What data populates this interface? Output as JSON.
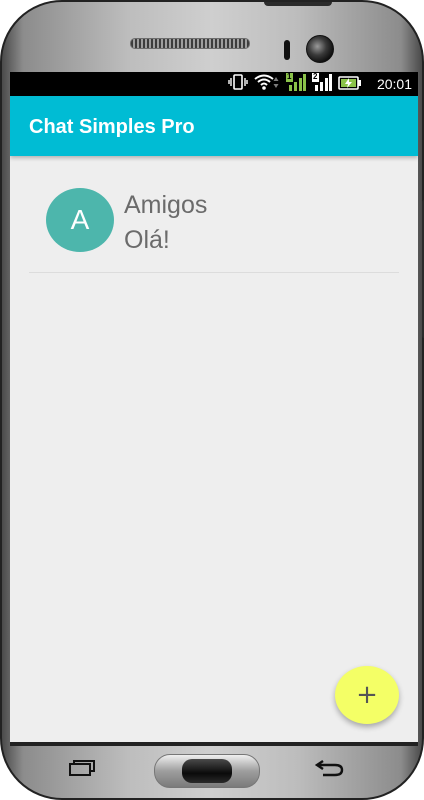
{
  "status_bar": {
    "time": "20:01",
    "icons": [
      "vibrate-icon",
      "wifi-icon",
      "signal-sim1-icon",
      "signal-sim2-icon",
      "battery-charging-icon"
    ],
    "sim1_label": "1",
    "sim2_label": "2"
  },
  "toolbar": {
    "title": "Chat Simples Pro"
  },
  "chats": [
    {
      "avatar_letter": "A",
      "name": "Amigos",
      "last_message": "Olá!"
    }
  ],
  "fab": {
    "icon": "plus-icon",
    "glyph": "+"
  },
  "nav_bar": {
    "icons": [
      "recent-apps-icon",
      "home-button",
      "back-icon"
    ]
  },
  "colors": {
    "toolbar": "#00bcd4",
    "avatar": "#4db6ac",
    "fab": "#f4ff66",
    "background": "#eeeeee",
    "text": "#6b6b6b"
  }
}
